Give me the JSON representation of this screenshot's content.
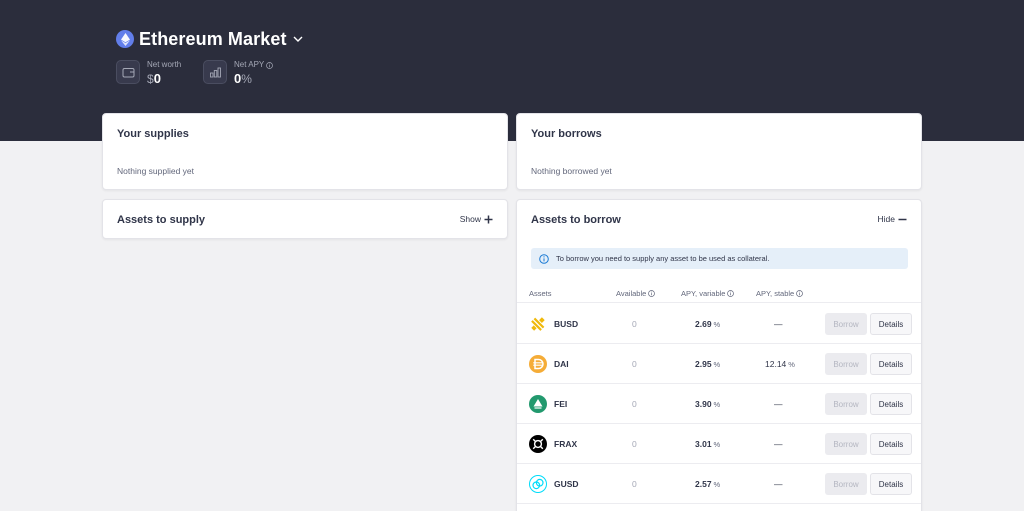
{
  "header": {
    "market_title": "Ethereum Market",
    "net_worth": {
      "label": "Net worth",
      "currency": "$",
      "value": "0"
    },
    "net_apy": {
      "label": "Net APY",
      "value": "0",
      "unit": "%"
    }
  },
  "supplies": {
    "title": "Your supplies",
    "empty_text": "Nothing supplied yet"
  },
  "borrows": {
    "title": "Your borrows",
    "empty_text": "Nothing borrowed yet"
  },
  "assets_to_supply": {
    "title": "Assets to supply",
    "toggle_label": "Show"
  },
  "assets_to_borrow": {
    "title": "Assets to borrow",
    "toggle_label": "Hide",
    "info_text": "To borrow you need to supply any asset to be used as collateral.",
    "columns": {
      "assets": "Assets",
      "available": "Available",
      "apy_variable": "APY, variable",
      "apy_stable": "APY, stable"
    },
    "rows": [
      {
        "symbol": "BUSD",
        "available": "0",
        "apy_variable": "2.69",
        "apy_stable": "—",
        "icon": "busd-icon",
        "color": "#f0b90b"
      },
      {
        "symbol": "DAI",
        "available": "0",
        "apy_variable": "2.95",
        "apy_stable": "12.14",
        "icon": "dai-icon",
        "color": "#f5ac37"
      },
      {
        "symbol": "FEI",
        "available": "0",
        "apy_variable": "3.90",
        "apy_stable": "—",
        "icon": "fei-icon",
        "color": "#22996e"
      },
      {
        "symbol": "FRAX",
        "available": "0",
        "apy_variable": "3.01",
        "apy_stable": "—",
        "icon": "frax-icon",
        "color": "#000000"
      },
      {
        "symbol": "GUSD",
        "available": "0",
        "apy_variable": "2.57",
        "apy_stable": "—",
        "icon": "gusd-icon",
        "color": "#00dcfa"
      }
    ],
    "borrow_label": "Borrow",
    "details_label": "Details",
    "percent_unit": "%"
  },
  "colors": {
    "hero_bg": "#2b2d3c",
    "page_bg": "#f1f1f3",
    "info_bg": "#e5eff9",
    "eth": "#627eea"
  }
}
